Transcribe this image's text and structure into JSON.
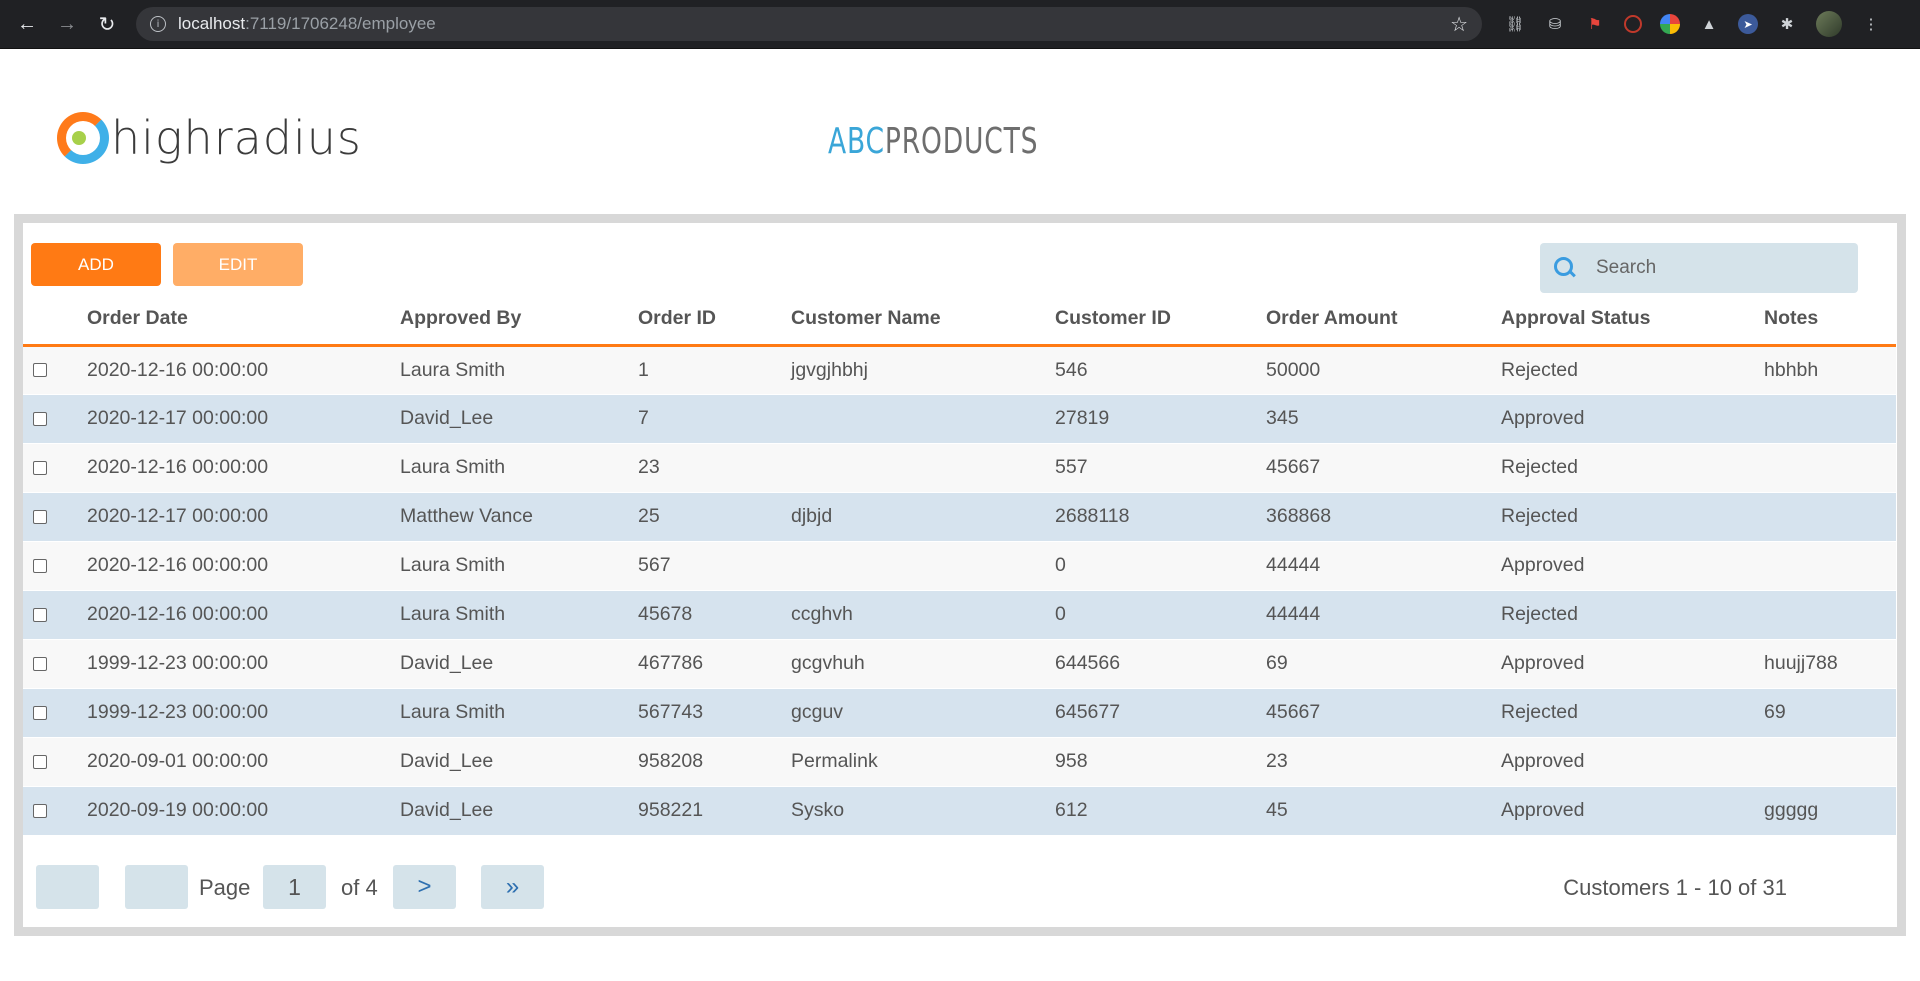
{
  "browser": {
    "url_host": "localhost",
    "url_path": ":7119/1706248/employee"
  },
  "header": {
    "logo_text": "highradius",
    "product_abc": "ABC",
    "product_rest": "PRODUCTS"
  },
  "toolbar": {
    "add_label": "ADD",
    "edit_label": "EDIT",
    "search_placeholder": "Search"
  },
  "table": {
    "columns": [
      "Order Date",
      "Approved By",
      "Order ID",
      "Customer Name",
      "Customer ID",
      "Order Amount",
      "Approval Status",
      "Notes"
    ],
    "rows": [
      [
        "2020-12-16 00:00:00",
        "Laura Smith",
        "1",
        "jgvgjhbhj",
        "546",
        "50000",
        "Rejected",
        "hbhbh"
      ],
      [
        "2020-12-17 00:00:00",
        "David_Lee",
        "7",
        "",
        "27819",
        "345",
        "Approved",
        ""
      ],
      [
        "2020-12-16 00:00:00",
        "Laura Smith",
        "23",
        "",
        "557",
        "45667",
        "Rejected",
        ""
      ],
      [
        "2020-12-17 00:00:00",
        "Matthew Vance",
        "25",
        "djbjd",
        "2688118",
        "368868",
        "Rejected",
        ""
      ],
      [
        "2020-12-16 00:00:00",
        "Laura Smith",
        "567",
        "",
        "0",
        "44444",
        "Approved",
        ""
      ],
      [
        "2020-12-16 00:00:00",
        "Laura Smith",
        "45678",
        "ccghvh",
        "0",
        "44444",
        "Rejected",
        ""
      ],
      [
        "1999-12-23 00:00:00",
        "David_Lee",
        "467786",
        "gcgvhuh",
        "644566",
        "69",
        "Approved",
        "huujj788"
      ],
      [
        "1999-12-23 00:00:00",
        "Laura Smith",
        "567743",
        "gcguv",
        "645677",
        "45667",
        "Rejected",
        "69"
      ],
      [
        "2020-09-01 00:00:00",
        "David_Lee",
        "958208",
        "Permalink",
        "958",
        "23",
        "Approved",
        ""
      ],
      [
        "2020-09-19 00:00:00",
        "David_Lee",
        "958221",
        "Sysko",
        "612",
        "45",
        "Approved",
        "ggggg"
      ]
    ]
  },
  "pagination": {
    "page_label": "Page",
    "current_page": "1",
    "of_label": "of 4",
    "next_label": ">",
    "last_label": "»",
    "count_text": "Customers 1 - 10 of 31"
  }
}
